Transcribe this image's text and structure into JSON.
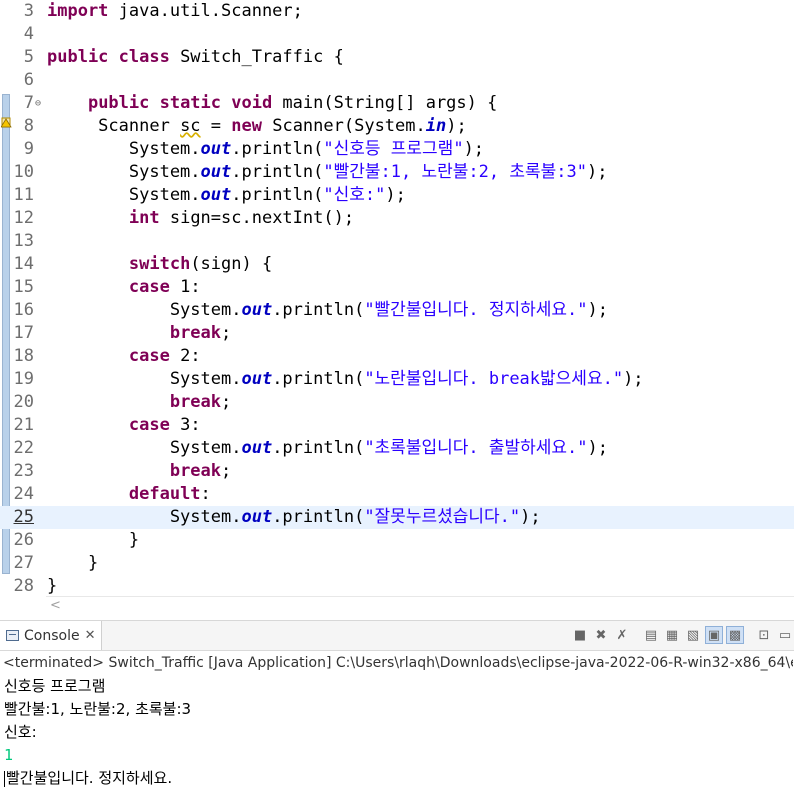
{
  "editor": {
    "lines": [
      {
        "num": "3",
        "code": "<span class=\"kw\">import</span> java.util.Scanner;"
      },
      {
        "num": "4",
        "code": ""
      },
      {
        "num": "5",
        "code": "<span class=\"kw\">public class</span> Switch_Traffic {"
      },
      {
        "num": "6",
        "code": ""
      },
      {
        "num": "7",
        "code": "    <span class=\"kw\">public static void</span> main(String[] args) {",
        "fold": "⊖"
      },
      {
        "num": "8",
        "code": "     Scanner <span class=\"warnvar\">sc</span> = <span class=\"kw\">new</span> Scanner(System.<span class=\"fld\">in</span>);"
      },
      {
        "num": "9",
        "code": "        System.<span class=\"fld\">out</span>.println(<span class=\"str\">\"신호등 프로그램\"</span>);"
      },
      {
        "num": "10",
        "code": "        System.<span class=\"fld\">out</span>.println(<span class=\"str\">\"빨간불:1, 노란불:2, 초록불:3\"</span>);"
      },
      {
        "num": "11",
        "code": "        System.<span class=\"fld\">out</span>.println(<span class=\"str\">\"신호:\"</span>);"
      },
      {
        "num": "12",
        "code": "        <span class=\"kw\">int</span> sign=sc.nextInt();"
      },
      {
        "num": "13",
        "code": ""
      },
      {
        "num": "14",
        "code": "        <span class=\"kw\">switch</span>(sign) {"
      },
      {
        "num": "15",
        "code": "        <span class=\"kw\">case</span> 1:"
      },
      {
        "num": "16",
        "code": "            System.<span class=\"fld\">out</span>.println(<span class=\"str\">\"빨간불입니다. 정지하세요.\"</span>);"
      },
      {
        "num": "17",
        "code": "            <span class=\"kw\">break</span>;"
      },
      {
        "num": "18",
        "code": "        <span class=\"kw\">case</span> 2:"
      },
      {
        "num": "19",
        "code": "            System.<span class=\"fld\">out</span>.println(<span class=\"str\">\"노란불입니다. break밟으세요.\"</span>);"
      },
      {
        "num": "20",
        "code": "            <span class=\"kw\">break</span>;"
      },
      {
        "num": "21",
        "code": "        <span class=\"kw\">case</span> 3:"
      },
      {
        "num": "22",
        "code": "            System.<span class=\"fld\">out</span>.println(<span class=\"str\">\"초록불입니다. 출발하세요.\"</span>);"
      },
      {
        "num": "23",
        "code": "            <span class=\"kw\">break</span>;"
      },
      {
        "num": "24",
        "code": "        <span class=\"kw\">default</span>:"
      },
      {
        "num": "25",
        "code": "            System.<span class=\"fld\">out</span>.println(<span class=\"str\">\"잘못누르셨습니다.\"</span>);",
        "current": true
      },
      {
        "num": "26",
        "code": "        }"
      },
      {
        "num": "27",
        "code": "    }"
      },
      {
        "num": "28",
        "code": "}"
      }
    ]
  },
  "console": {
    "tab_label": "Console",
    "terminated": "<terminated> Switch_Traffic [Java Application] C:\\Users\\rlaqh\\Downloads\\eclipse-java-2022-06-R-win32-x86_64\\eclipse",
    "output": [
      {
        "text": "신호등 프로그램"
      },
      {
        "text": "빨간불:1, 노란불:2, 초록불:3"
      },
      {
        "text": "신호:"
      },
      {
        "text": "1",
        "input": true
      },
      {
        "text": "빨간불입니다. 정지하세요.",
        "caret": true
      }
    ]
  }
}
